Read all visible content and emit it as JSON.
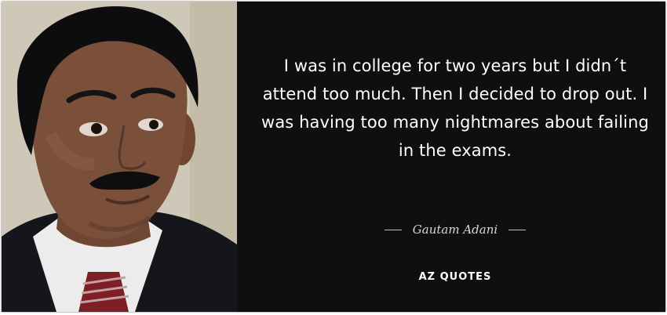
{
  "quote": {
    "text": "I was in college for two years but I didn´t attend too much. Then I decided to drop out. I was having too many nightmares about failing in the exams.",
    "author": "Gautam Adani"
  },
  "brand": {
    "logo_text": "AZ QUOTES"
  },
  "colors": {
    "background": "#0f0f0f",
    "text": "#ffffff",
    "author": "#d8d8d8"
  }
}
